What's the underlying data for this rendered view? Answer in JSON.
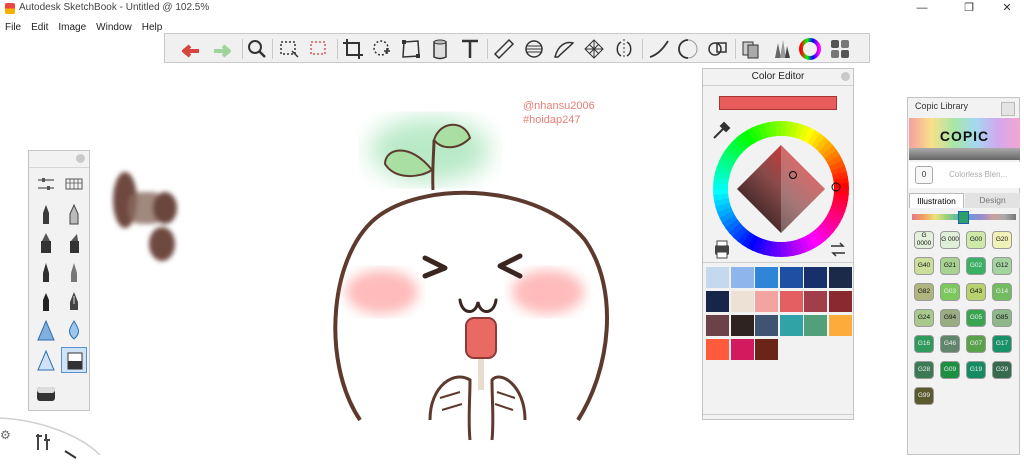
{
  "window": {
    "title": "Autodesk SketchBook - Untitled @ 102.5%",
    "minimize_glyph": "—",
    "maximize_glyph": "❐",
    "close_glyph": "✕"
  },
  "menu": [
    "File",
    "Edit",
    "Image",
    "Window",
    "Help"
  ],
  "toolbar_icons": [
    "undo-icon",
    "redo-icon",
    "zoom-icon",
    "rect-select-icon",
    "magic-select-icon",
    "crop-icon",
    "lasso-icon",
    "distort-icon",
    "bucket-icon",
    "text-icon",
    "ruler-icon",
    "ellipse-guide-icon",
    "french-curve-icon",
    "perspective-icon",
    "symmetry-icon",
    "steady-stroke-icon",
    "predictive-stroke-icon",
    "shape-icon",
    "copy-paste-icon",
    "brush-palette-icon",
    "color-puck-icon",
    "layer-editor-icon"
  ],
  "watermark": [
    "@nhansu2006",
    "#hoidap247"
  ],
  "color_editor": {
    "title": "Color Editor",
    "current_color": "#e85c5c",
    "swatches": [
      "#c5d9ee",
      "#8fb6ec",
      "#2f85d8",
      "#1d4fa3",
      "#17306b",
      "#1c2a4a",
      "#172548",
      "#ede0d4",
      "#f3a3a0",
      "#e35f61",
      "#a23d4a",
      "#8b2a2e",
      "#6b4248",
      "#2f2320",
      "#3f5470",
      "#2fa3a7",
      "#52a07a",
      "#fbac3a",
      "#ff5a3b",
      "#d3195f",
      "#6b2418"
    ]
  },
  "copic": {
    "title": "Copic Library",
    "logo": "COPIC",
    "colorless_number": "0",
    "colorless_label": "Colorless Blen...",
    "tabs": [
      "Illustration",
      "Design"
    ],
    "markers": [
      {
        "code": "G 0000",
        "color": "#e3f0db"
      },
      {
        "code": "G 000",
        "color": "#e0efd7"
      },
      {
        "code": "G00",
        "color": "#cdeaa9"
      },
      {
        "code": "G20",
        "color": "#f0f2b8"
      },
      {
        "code": "G40",
        "color": "#cbdf9a"
      },
      {
        "code": "G21",
        "color": "#a8d28f"
      },
      {
        "code": "G02",
        "color": "#39b063"
      },
      {
        "code": "G12",
        "color": "#a3d4a0"
      },
      {
        "code": "G82",
        "color": "#b1b57d"
      },
      {
        "code": "G03",
        "color": "#7bc95d"
      },
      {
        "code": "G43",
        "color": "#bad26e"
      },
      {
        "code": "G14",
        "color": "#71bc5e"
      },
      {
        "code": "G24",
        "color": "#a9c98d"
      },
      {
        "code": "G94",
        "color": "#9aad82"
      },
      {
        "code": "G05",
        "color": "#3aa551"
      },
      {
        "code": "G85",
        "color": "#8eb88a"
      },
      {
        "code": "G16",
        "color": "#2e9a5c"
      },
      {
        "code": "G46",
        "color": "#61856a"
      },
      {
        "code": "G07",
        "color": "#58a24a"
      },
      {
        "code": "G17",
        "color": "#179168"
      },
      {
        "code": "G28",
        "color": "#3c7a56"
      },
      {
        "code": "G09",
        "color": "#1c8f43"
      },
      {
        "code": "G19",
        "color": "#158a63"
      },
      {
        "code": "G29",
        "color": "#356a4f"
      },
      {
        "code": "G99",
        "color": "#5b5a2f"
      }
    ]
  },
  "left_tools": [
    "brush-properties-icon",
    "brush-library-icon",
    "pencil-icon",
    "airbrush-icon",
    "marker-icon",
    "chisel-marker-icon",
    "pen-icon",
    "ink-pen-icon",
    "ballpoint-icon",
    "calligraphy-pen-icon",
    "smudge-cone-icon",
    "blur-drop-icon",
    "hard-cone-icon",
    "eraser-icon",
    "partial-eraser-icon"
  ]
}
